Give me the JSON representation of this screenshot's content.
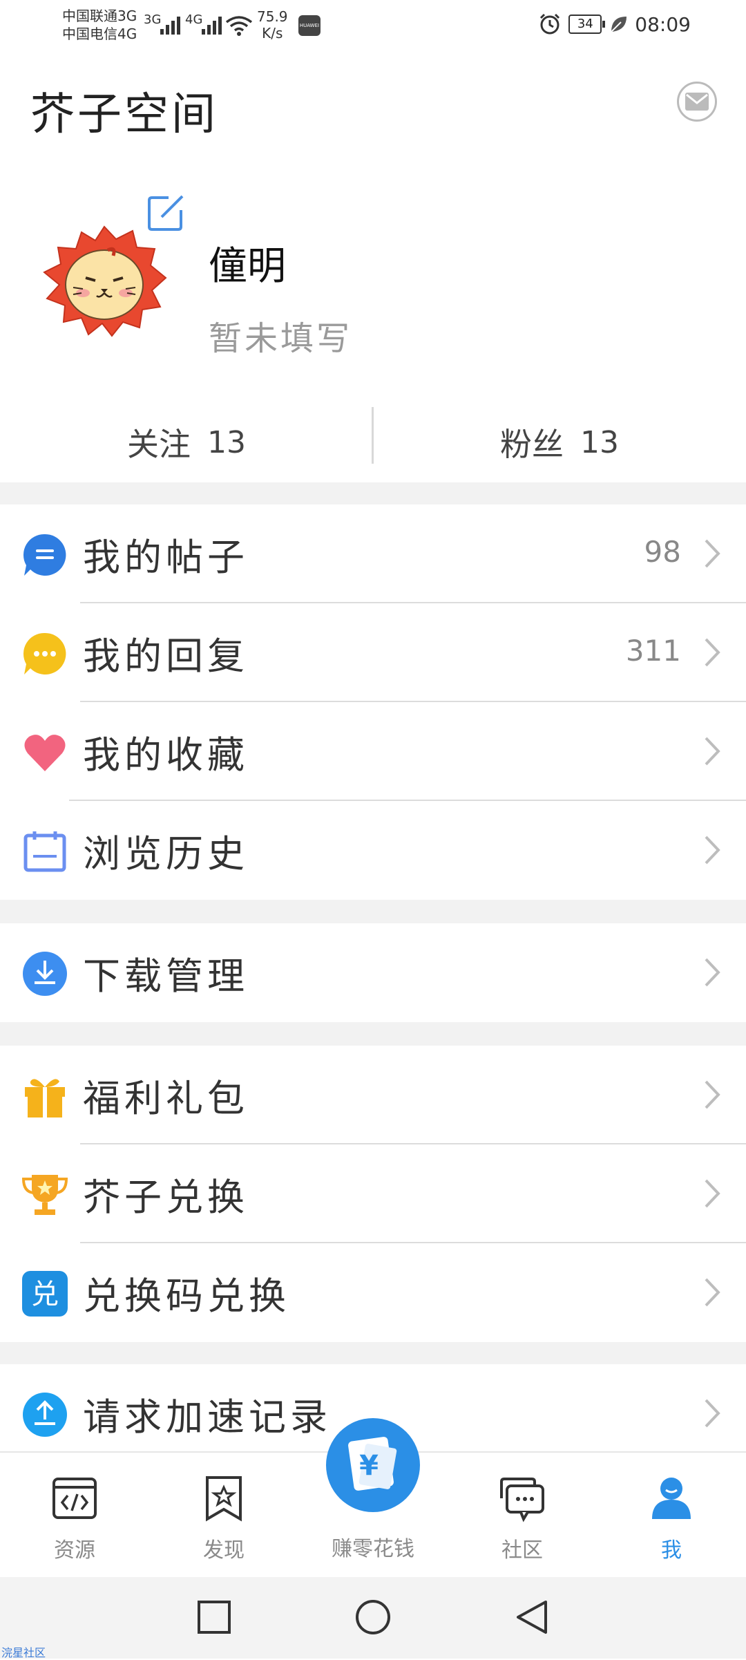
{
  "status_bar": {
    "carrier1": "中国联通3G",
    "carrier2": "中国电信4G",
    "net1": "3G",
    "net2": "4G",
    "speed_value": "75.9",
    "speed_unit": "K/s",
    "huawei_label": "HUAWEI",
    "battery": "34",
    "time": "08:09"
  },
  "header": {
    "title": "芥子空间"
  },
  "profile": {
    "nickname": "僮明",
    "bio": "暂未填写"
  },
  "stats": {
    "following_label": "关注",
    "following_count": "13",
    "followers_label": "粉丝",
    "followers_count": "13"
  },
  "menu": {
    "group1": [
      {
        "label": "我的帖子",
        "count": "98",
        "icon": "chat-bubble-blue-icon"
      },
      {
        "label": "我的回复",
        "count": "311",
        "icon": "chat-bubble-yellow-icon"
      },
      {
        "label": "我的收藏",
        "count": "",
        "icon": "heart-icon"
      },
      {
        "label": "浏览历史",
        "count": "",
        "icon": "calendar-icon"
      }
    ],
    "group2": [
      {
        "label": "下载管理",
        "icon": "download-icon"
      }
    ],
    "group3": [
      {
        "label": "福利礼包",
        "icon": "gift-icon"
      },
      {
        "label": "芥子兑换",
        "icon": "trophy-icon"
      },
      {
        "label": "兑换码兑换",
        "icon": "redeem-icon",
        "icon_text": "兑"
      }
    ],
    "group4": [
      {
        "label": "请求加速记录",
        "icon": "upload-icon"
      }
    ]
  },
  "tabs": {
    "resources": "资源",
    "discover": "发现",
    "earn": "赚零花钱",
    "earn_symbol": "¥",
    "community": "社区",
    "me": "我"
  },
  "colors": {
    "accent": "#2b8fe6",
    "lion_mane": "#e8482f",
    "lion_face": "#fbe3a6",
    "gold": "#f5b21b",
    "heart": "#f2647f"
  },
  "watermark": "浣星社区"
}
